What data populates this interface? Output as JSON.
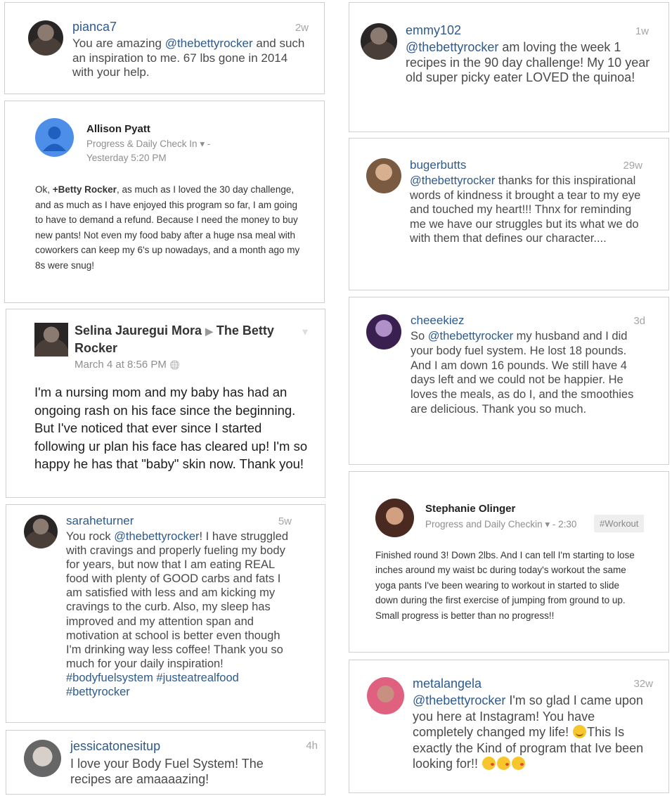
{
  "cards": {
    "pianca7": {
      "user": "pianca7",
      "time": "2w",
      "mention": "@thebettyrocker",
      "text_before": "You are amazing ",
      "text_after": " and such an inspiration to me. 67 lbs gone in 2014 with your help."
    },
    "allison": {
      "name": "Allison Pyatt",
      "community": "Progress & Daily Check In",
      "dash": "-",
      "time": "Yesterday 5:20 PM",
      "text_start": "Ok, ",
      "plus_mention": "+Betty Rocker",
      "text_rest": ", as much as I loved the 30 day challenge, and as much as I have enjoyed this program so far, I am going to have to demand a refund. Because I need the money to buy new pants! Not even my food baby after a huge nsa meal with coworkers can keep my 6's up nowadays, and a month ago my 8s were snug!"
    },
    "selina": {
      "name": "Selina Jauregui Mora",
      "arrow": "▶",
      "target": "The Betty Rocker",
      "time": "March 4 at 8:56 PM",
      "text": "I'm a nursing mom and my baby has had an ongoing rash on his face since the beginning.  But I've noticed that ever since I started following ur plan his face has cleared up! I'm so happy he has that \"baby\" skin now.  Thank you!"
    },
    "sarah": {
      "user": "saraheturner",
      "time": "5w",
      "text_before": "You rock ",
      "mention": "@thebettyrocker",
      "text_after": "! I have struggled with cravings and properly fueling my body for years, but now that I am eating REAL food with plenty of GOOD carbs and fats I am satisfied with less and am kicking my cravings to the curb. Also, my sleep has improved and my attention span and motivation at school is better even though I'm drinking way less coffee! Thank you so much for your daily inspiration! ",
      "hashtags": "#bodyfuelsystem #justeatrealfood #bettyrocker"
    },
    "jessica": {
      "user": "jessicatonesitup",
      "time": "4h",
      "text": "I love your Body Fuel System! The recipes are amaaaazing!"
    },
    "emmy": {
      "user": "emmy102",
      "time": "1w",
      "mention": "@thebettyrocker",
      "text_after": " am loving the week 1 recipes in the 90 day challenge! My 10 year old super picky eater LOVED the quinoa!"
    },
    "buger": {
      "user": "bugerbutts",
      "time": "29w",
      "mention": "@thebettyrocker",
      "text_after": " thanks for this inspirational words of kindness it brought a tear to my eye and touched my heart!!! Thnx for reminding me we have our struggles but its what we do with them that defines our character...."
    },
    "cheeek": {
      "user": "cheeekiez",
      "time": "3d",
      "text_before": "So ",
      "mention": "@thebettyrocker",
      "text_after": " my husband and I did your body fuel system. He lost 18 pounds. And I am down 16 pounds. We still have 4 days left and we could not be happier. He loves the meals, as do I, and the smoothies are delicious. Thank you so much."
    },
    "stephanie": {
      "name": "Stephanie Olinger",
      "community": "Progress and Daily Checkin",
      "time": "- 2:30",
      "tag": "#Workout",
      "text": "Finished round 3! Down 2lbs. And I can tell I'm starting to lose inches around my waist bc during today's workout the same yoga pants I've been wearing to workout in started to slide down during the first exercise of jumping from ground to up. Small progress is better than no progress!!"
    },
    "metal": {
      "user": "metalangela",
      "time": "32w",
      "mention": "@thebettyrocker",
      "text_a": " I'm so glad I came upon you here at Instagram! You have completely changed my life! ",
      "text_b": "This Is exactly the Kind of program that Ive been looking for!! "
    }
  },
  "icons": {
    "dropdown": "▾",
    "globe": "🌐",
    "heart_menu": "❤"
  },
  "colors": {
    "link": "#2e5a8c",
    "muted": "#a5a5a5",
    "border": "#cfcfcf"
  }
}
